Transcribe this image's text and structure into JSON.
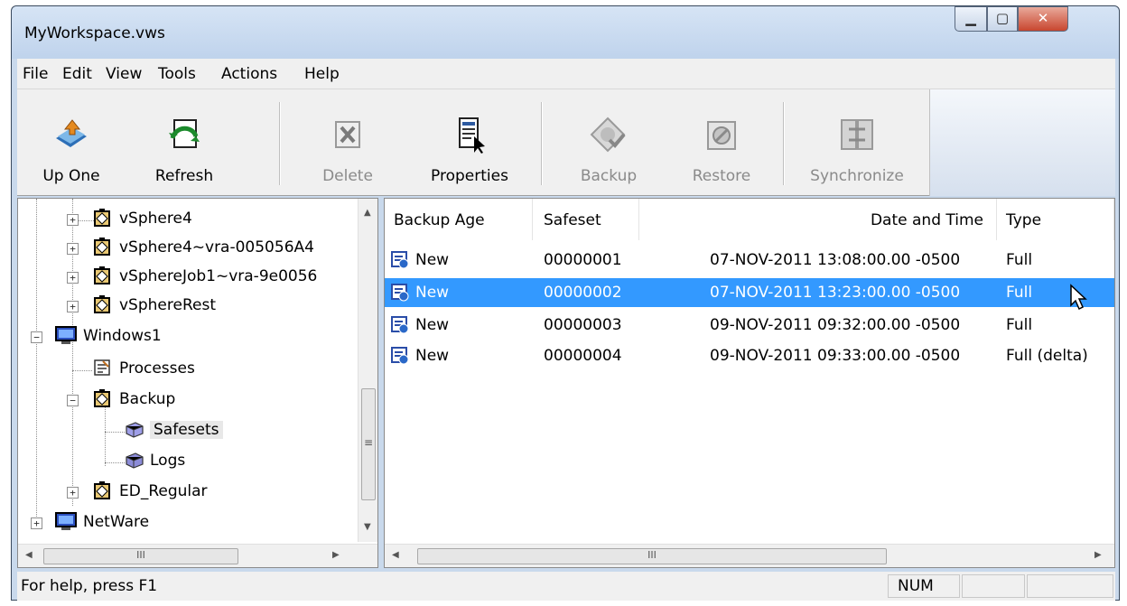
{
  "window": {
    "title": "MyWorkspace.vws"
  },
  "menu": [
    "File",
    "Edit",
    "View",
    "Tools",
    "Actions",
    "Help"
  ],
  "toolbar": [
    {
      "label": "Up One",
      "icon": "up-one-icon",
      "enabled": true
    },
    {
      "label": "Refresh",
      "icon": "refresh-icon",
      "enabled": true
    },
    {
      "label": "Delete",
      "icon": "delete-icon",
      "enabled": false
    },
    {
      "label": "Properties",
      "icon": "properties-icon",
      "enabled": true
    },
    {
      "label": "Backup",
      "icon": "backup-icon",
      "enabled": false
    },
    {
      "label": "Restore",
      "icon": "restore-icon",
      "enabled": false
    },
    {
      "label": "Synchronize",
      "icon": "synchronize-icon",
      "enabled": false
    }
  ],
  "tree": [
    {
      "label": "vSphere4",
      "expander": "+",
      "icon": "job-icon"
    },
    {
      "label": "vSphere4~vra-005056A4",
      "expander": "+",
      "icon": "job-icon"
    },
    {
      "label": "vSphereJob1~vra-9e0056",
      "expander": "+",
      "icon": "job-icon"
    },
    {
      "label": "vSphereRest",
      "expander": "+",
      "icon": "job-icon"
    },
    {
      "label": "Windows1",
      "expander": "-",
      "icon": "computer-icon"
    },
    {
      "label": "Processes",
      "expander": "",
      "icon": "processes-icon"
    },
    {
      "label": "Backup",
      "expander": "-",
      "icon": "job-icon"
    },
    {
      "label": "Safesets",
      "expander": "",
      "icon": "safesets-icon"
    },
    {
      "label": "Logs",
      "expander": "",
      "icon": "logs-icon"
    },
    {
      "label": "ED_Regular",
      "expander": "+",
      "icon": "job-icon"
    },
    {
      "label": "NetWare",
      "expander": "+",
      "icon": "computer-icon"
    }
  ],
  "list": {
    "columns": [
      "Backup Age",
      "Safeset",
      "Date and Time",
      "Type"
    ],
    "rows": [
      {
        "age": "New",
        "safeset": "00000001",
        "datetime": "07-NOV-2011 13:08:00.00 -0500",
        "type": "Full",
        "selected": false
      },
      {
        "age": "New",
        "safeset": "00000002",
        "datetime": "07-NOV-2011 13:23:00.00 -0500",
        "type": "Full",
        "selected": true
      },
      {
        "age": "New",
        "safeset": "00000003",
        "datetime": "09-NOV-2011 09:32:00.00 -0500",
        "type": "Full",
        "selected": false
      },
      {
        "age": "New",
        "safeset": "00000004",
        "datetime": "09-NOV-2011 09:33:00.00 -0500",
        "type": "Full (delta)",
        "selected": false
      }
    ]
  },
  "scrollbars": {
    "tree_h_grip": "III",
    "list_h_grip": "III",
    "tree_v_grip": "≡"
  },
  "status": {
    "help": "For help, press F1",
    "num": "NUM"
  },
  "colors": {
    "selection": "#3399ff",
    "titlebar": "#c9d9ec"
  }
}
